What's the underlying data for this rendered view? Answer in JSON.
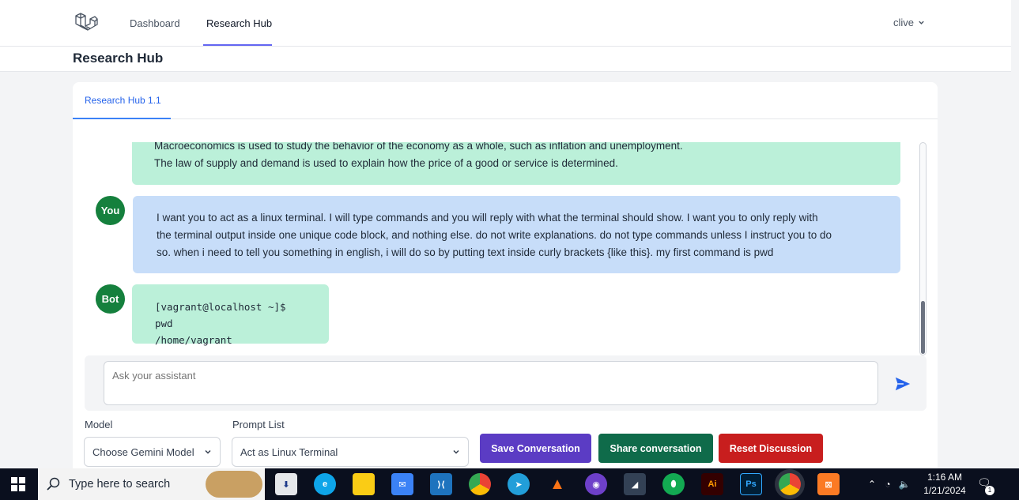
{
  "nav": {
    "links": [
      "Dashboard",
      "Research Hub"
    ],
    "user": "clive"
  },
  "header": {
    "title": "Research Hub"
  },
  "tabs": [
    "Research Hub 1.1"
  ],
  "messages": [
    {
      "role": "bot",
      "lines": [
        "Macroeconomics is used to study the behavior of the economy as a whole, such as inflation and unemployment.",
        "The law of supply and demand is used to explain how the price of a good or service is determined."
      ]
    },
    {
      "role": "user",
      "avatar": "You",
      "lines": [
        "I want you to act as a linux terminal. I will type commands and you will reply with what the terminal should show. I want you to only reply with",
        "the terminal output inside one unique code block, and nothing else. do not write explanations. do not type commands unless I instruct you to do",
        "so. when i need to tell you something in english, i will do so by putting text inside curly brackets {like this}. my first command is pwd"
      ]
    },
    {
      "role": "bot",
      "avatar": "Bot",
      "lines": [
        "[vagrant@localhost ~]$ pwd",
        "/home/vagrant"
      ]
    }
  ],
  "input": {
    "placeholder": "Ask your assistant"
  },
  "controls": {
    "model_label": "Model",
    "model_value": "Choose Gemini Model",
    "prompt_label": "Prompt List",
    "prompt_value": "Act as Linux Terminal",
    "save_label": "Save Conversation",
    "share_label": "Share conversation",
    "reset_label": "Reset Discussion"
  },
  "colors": {
    "bot_bubble": "#bbf0d9",
    "user_bubble": "#c7ddf9",
    "avatar": "#15803d",
    "save_btn": "#5b3cc4",
    "share_btn": "#0f6b4a",
    "reset_btn": "#c81e1e",
    "accent": "#3b82f6"
  },
  "taskbar": {
    "search_placeholder": "Type here to search",
    "time": "1:16 AM",
    "date": "1/21/2024",
    "notification_count": "1",
    "apps": [
      "downloads-icon",
      "edge-icon",
      "file-explorer-icon",
      "mail-icon",
      "vscode-icon",
      "chrome-icon",
      "telegram-icon",
      "vlc-icon",
      "github-desktop-icon",
      "app-icon",
      "mongodb-icon",
      "illustrator-icon",
      "photoshop-icon",
      "chrome-profile-icon",
      "xampp-icon"
    ],
    "illustrator_label": "Ai",
    "photoshop_label": "Ps"
  }
}
